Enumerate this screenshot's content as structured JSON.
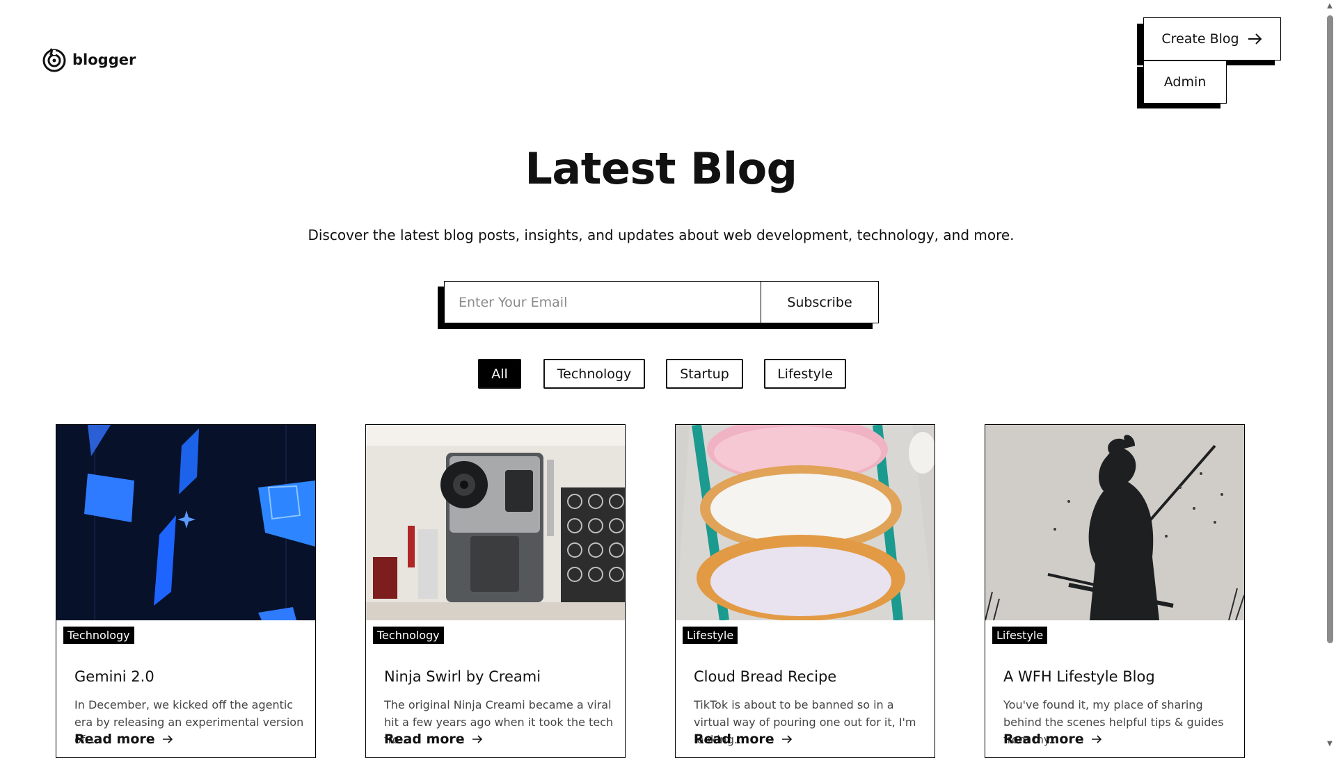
{
  "header": {
    "logo_text": "blogger",
    "create_blog_label": "Create Blog",
    "admin_label": "Admin"
  },
  "hero": {
    "title": "Latest Blog",
    "subtitle": "Discover the latest blog posts, insights, and updates about web development, technology, and more."
  },
  "subscribe": {
    "placeholder": "Enter Your Email",
    "button_label": "Subscribe"
  },
  "filters": [
    {
      "label": "All",
      "active": true
    },
    {
      "label": "Technology",
      "active": false
    },
    {
      "label": "Startup",
      "active": false
    },
    {
      "label": "Lifestyle",
      "active": false
    }
  ],
  "cards": [
    {
      "category": "Technology",
      "title": "Gemini 2.0",
      "description": "In December, we kicked off the agentic era by releasing an experimental version of...",
      "read_more": "Read more"
    },
    {
      "category": "Technology",
      "title": "Ninja Swirl by Creami",
      "description": "The original Ninja Creami became a viral hit a few years ago when it took the tech fro...",
      "read_more": "Read more"
    },
    {
      "category": "Lifestyle",
      "title": "Cloud Bread Recipe",
      "description": "TikTok is about to be banned so in a virtual way of pouring one out for it, I'm looking...",
      "read_more": "Read more"
    },
    {
      "category": "Lifestyle",
      "title": "A WFH Lifestyle Blog",
      "description": "You've found it, my place of sharing behind the scenes helpful tips & guides from my...",
      "read_more": "Read more"
    }
  ],
  "colors": {
    "primary": "#000000",
    "background": "#ffffff",
    "tag_text": "#ffffff"
  }
}
